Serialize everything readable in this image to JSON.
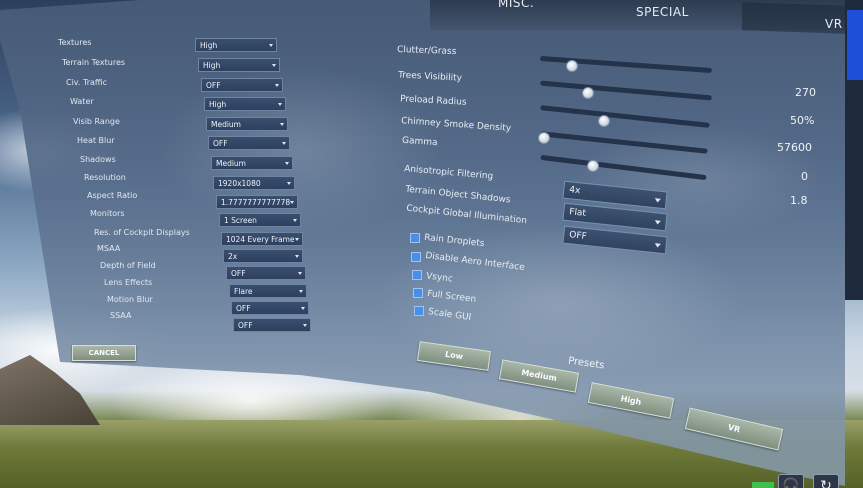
{
  "tabs": {
    "misc": "MISC.",
    "special": "SPECIAL",
    "vr": "VR"
  },
  "left_settings": [
    {
      "label": "Textures",
      "value": "High"
    },
    {
      "label": "Terrain Textures",
      "value": "High"
    },
    {
      "label": "Civ. Traffic",
      "value": "OFF"
    },
    {
      "label": "Water",
      "value": "High"
    },
    {
      "label": "Visib Range",
      "value": "Medium"
    },
    {
      "label": "Heat Blur",
      "value": "OFF"
    },
    {
      "label": "Shadows",
      "value": "Medium"
    },
    {
      "label": "Resolution",
      "value": "1920x1080"
    },
    {
      "label": "Aspect Ratio",
      "value": "1.7777777777778"
    },
    {
      "label": "Monitors",
      "value": "1 Screen"
    },
    {
      "label": "Res. of Cockpit Displays",
      "value": "1024 Every Frame"
    },
    {
      "label": "MSAA",
      "value": "2x"
    },
    {
      "label": "Depth of Field",
      "value": "OFF"
    },
    {
      "label": "Lens Effects",
      "value": "Flare"
    },
    {
      "label": "Motion Blur",
      "value": "OFF"
    },
    {
      "label": "SSAA",
      "value": "OFF"
    }
  ],
  "sliders": [
    {
      "label": "Clutter/Grass",
      "value": "270",
      "level": 0.2
    },
    {
      "label": "Trees Visibility",
      "value": "50%",
      "level": 0.3
    },
    {
      "label": "Preload Radius",
      "value": "57600",
      "level": 0.4
    },
    {
      "label": "Chimney Smoke Density",
      "value": "0",
      "level": 0.0
    },
    {
      "label": "Gamma",
      "value": "1.8",
      "level": 0.33
    }
  ],
  "right_dropdowns": [
    {
      "label": "Anisotropic Filtering",
      "value": "4x"
    },
    {
      "label": "Terrain Object Shadows",
      "value": "Flat"
    },
    {
      "label": "Cockpit Global Illumination",
      "value": "OFF"
    }
  ],
  "checkboxes": [
    {
      "label": "Rain Droplets"
    },
    {
      "label": "Disable Aero Interface"
    },
    {
      "label": "Vsync"
    },
    {
      "label": "Full Screen"
    },
    {
      "label": "Scale GUI"
    }
  ],
  "cancel_label": "CANCEL",
  "presets": {
    "label": "Presets",
    "buttons": [
      "Low",
      "Medium",
      "High",
      "VR"
    ]
  },
  "corner": {
    "headset_icon": "headset-icon",
    "refresh_icon": "refresh-icon"
  }
}
